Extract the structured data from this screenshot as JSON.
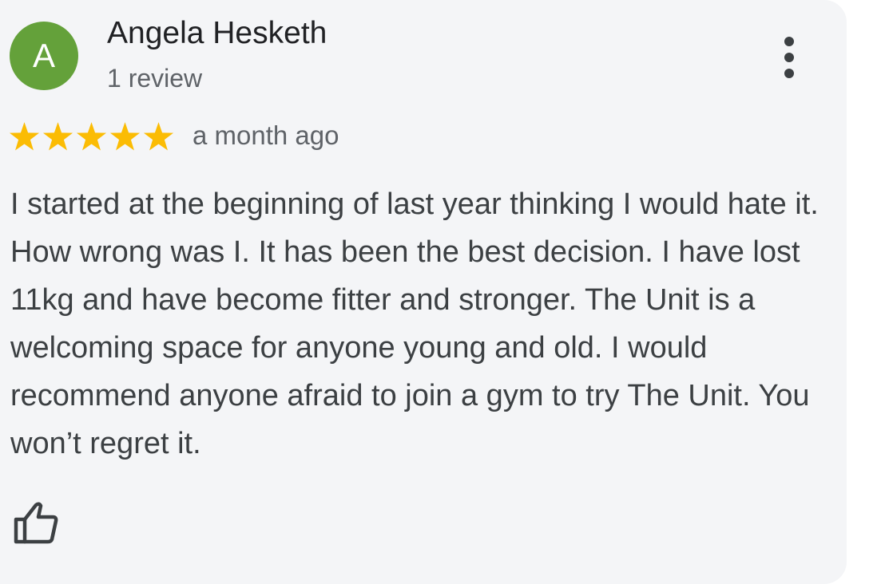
{
  "review": {
    "author": {
      "initial": "A",
      "name": "Angela Hesketh",
      "review_count": "1 review",
      "avatar_color": "#64a13a"
    },
    "rating": 5,
    "max_rating": 5,
    "star_color": "#fbbc04",
    "date": "a month ago",
    "text": "I started at the beginning of last year thinking I would hate it. How wrong was I. It has been the best decision. I have lost 11kg and have become fitter and stronger. The Unit is a welcoming space for anyone young and old. I would recommend anyone afraid to join a gym to try The Unit. You won’t regret it.",
    "actions": {
      "more_icon": "more-vert-icon",
      "like_icon": "thumb-up-outline-icon"
    }
  }
}
